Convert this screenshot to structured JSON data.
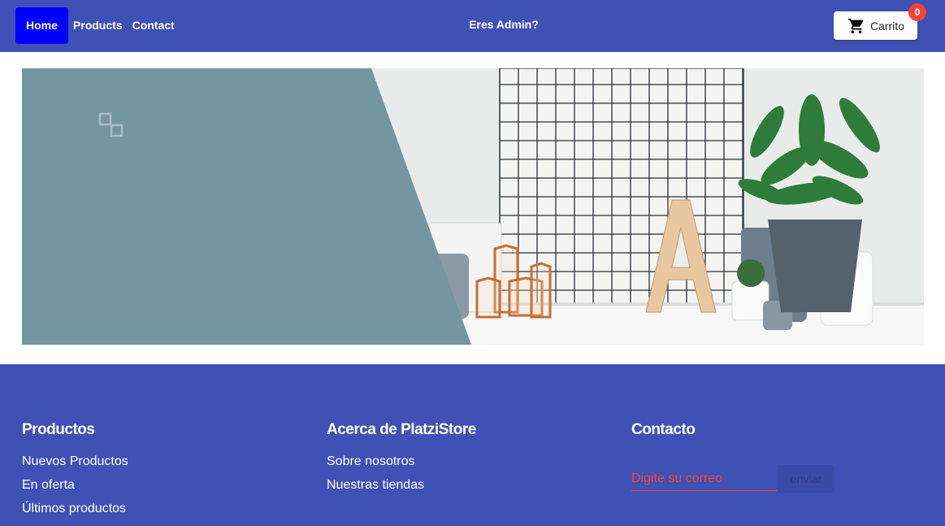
{
  "header": {
    "nav": [
      "Home",
      "Products",
      "Contact"
    ],
    "admin_link": "Eres Admin?",
    "cart_label": "Carrito",
    "cart_count": "0"
  },
  "footer": {
    "productos": {
      "title": "Productos",
      "items": [
        "Nuevos Productos",
        "En oferta",
        "Últimos productos"
      ]
    },
    "acerca": {
      "title": "Acerca de PlatziStore",
      "items": [
        "Sobre nosotros",
        "Nuestras tiendas"
      ]
    },
    "contacto": {
      "title": "Contacto",
      "email_placeholder": "Digite su correo",
      "send_label": "enviar"
    }
  },
  "colors": {
    "primary": "#3f51b5",
    "active_nav": "#0000ff",
    "badge": "#f44336",
    "banner_slate": "#7496a1"
  }
}
